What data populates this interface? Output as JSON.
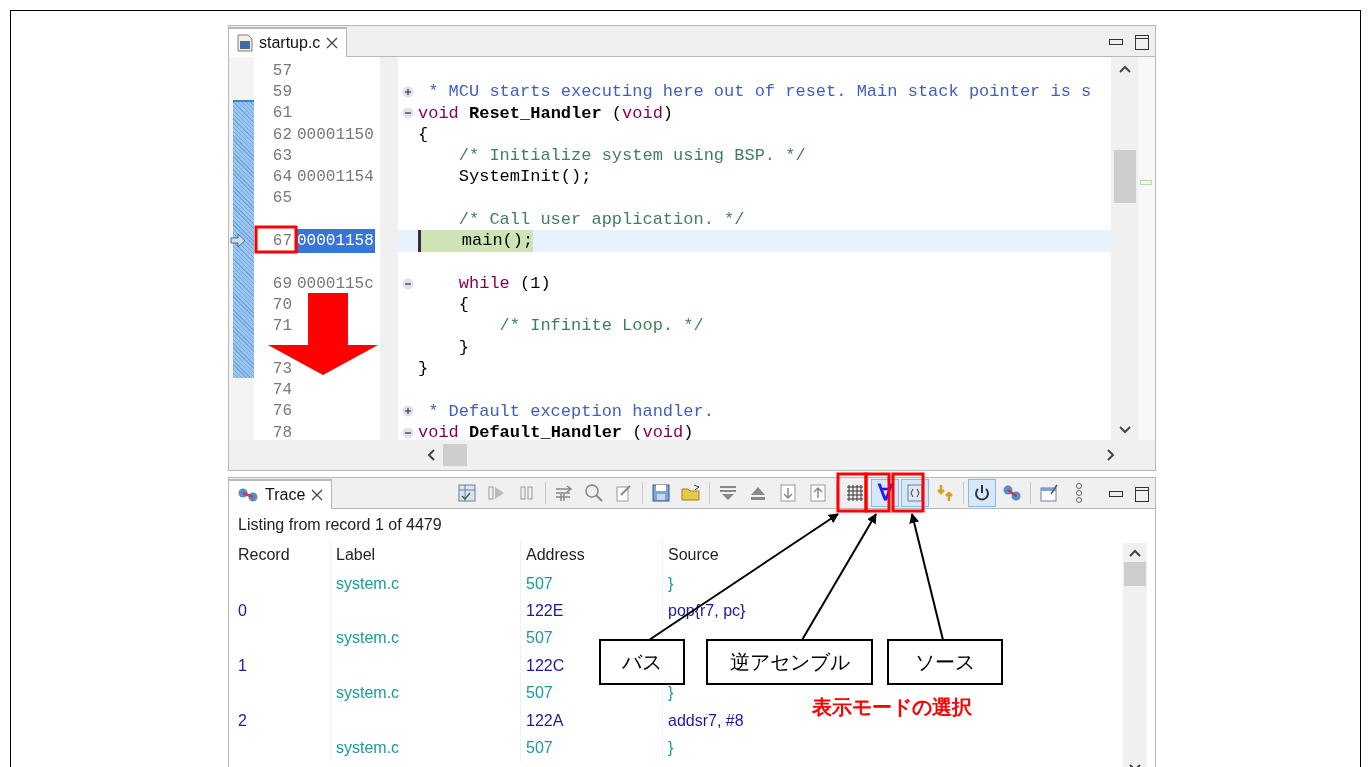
{
  "editor": {
    "tab": {
      "title": "startup.c",
      "selected": true
    },
    "lines": [
      {
        "number": "57",
        "current": false
      },
      {
        "number": "59",
        "expanded": false,
        "current": false,
        "code": [
          {
            "kind": "doc",
            "text": " * MCU starts executing here out of reset. Main stack pointer is s"
          }
        ]
      },
      {
        "number": "61",
        "expanded": true,
        "current": false,
        "code": [
          {
            "kind": "keyword",
            "text": "void"
          },
          {
            "kind": "name",
            "text": " Reset_Handler "
          },
          {
            "kind": "plain",
            "text": "("
          },
          {
            "kind": "keyword",
            "text": "void"
          },
          {
            "kind": "plain",
            "text": ")"
          }
        ]
      },
      {
        "number": "62",
        "address": "00001150",
        "current": false,
        "code": [
          {
            "kind": "plain",
            "text": "{"
          }
        ]
      },
      {
        "number": "63",
        "current": false,
        "code": [
          {
            "kind": "comment",
            "text": "    /* Initialize system using BSP. */"
          }
        ]
      },
      {
        "number": "64",
        "address": "00001154",
        "current": false,
        "code": [
          {
            "kind": "plain",
            "text": "    SystemInit();"
          }
        ]
      },
      {
        "number": "65",
        "current": false
      },
      {
        "current": false,
        "code": [
          {
            "kind": "comment",
            "text": "    /* Call user application. */"
          }
        ]
      },
      {
        "number": "67",
        "address": "00001158",
        "current": true,
        "code": [
          {
            "kind": "marked",
            "text": "    main();"
          }
        ]
      },
      {
        "current": false
      },
      {
        "number": "69",
        "address": "0000115c",
        "expanded": true,
        "current": false,
        "code": [
          {
            "kind": "keyword",
            "text": "    while"
          },
          {
            "kind": "plain",
            "text": " (1)"
          }
        ]
      },
      {
        "number": "70",
        "current": false,
        "code": [
          {
            "kind": "plain",
            "text": "    {"
          }
        ]
      },
      {
        "number": "71",
        "current": false,
        "code": [
          {
            "kind": "comment",
            "text": "        /* Infinite Loop. */"
          }
        ]
      },
      {
        "current": false,
        "code": [
          {
            "kind": "plain",
            "text": "    }"
          }
        ]
      },
      {
        "number": "73",
        "current": false,
        "code": [
          {
            "kind": "plain",
            "text": "}"
          }
        ]
      },
      {
        "number": "74",
        "current": false
      },
      {
        "number": "76",
        "expanded": false,
        "current": false,
        "code": [
          {
            "kind": "doc",
            "text": " * Default exception handler."
          }
        ]
      },
      {
        "number": "78",
        "expanded": true,
        "current": false,
        "code": [
          {
            "kind": "keyword",
            "text": "void"
          },
          {
            "kind": "name",
            "text": " Default_Handler "
          },
          {
            "kind": "plain",
            "text": "("
          },
          {
            "kind": "keyword",
            "text": "void"
          },
          {
            "kind": "plain",
            "text": ")"
          }
        ]
      }
    ]
  },
  "trace": {
    "tab": {
      "title": "Trace",
      "selected": true
    },
    "toolbar": [
      {
        "kind": "table",
        "selected": false
      },
      {
        "kind": "run",
        "selected": false
      },
      {
        "kind": "pause",
        "selected": false
      },
      {
        "kind": "separator"
      },
      {
        "kind": "arrows",
        "selected": false
      },
      {
        "kind": "search",
        "selected": false
      },
      {
        "kind": "edit",
        "selected": false
      },
      {
        "kind": "separator"
      },
      {
        "kind": "save",
        "selected": false
      },
      {
        "kind": "folder",
        "selected": false
      },
      {
        "kind": "separator"
      },
      {
        "kind": "filter",
        "selected": false
      },
      {
        "kind": "eject",
        "selected": false
      },
      {
        "kind": "stepdown",
        "selected": false
      },
      {
        "kind": "stepup",
        "selected": false
      },
      {
        "kind": "separator"
      },
      {
        "kind": "grid",
        "selected": false
      },
      {
        "kind": "glyph",
        "text": "∀",
        "selected": true
      },
      {
        "kind": "source",
        "selected": true
      },
      {
        "kind": "swap",
        "selected": false
      },
      {
        "kind": "separator"
      },
      {
        "kind": "power",
        "selected": true
      },
      {
        "kind": "link",
        "selected": false
      },
      {
        "kind": "separator"
      },
      {
        "kind": "window",
        "selected": false
      },
      {
        "kind": "dots",
        "selected": false
      }
    ],
    "listing": "Listing from record 1 of 4479",
    "columns": [
      "Record",
      "Label",
      "Address",
      "Source"
    ],
    "rows": [
      {
        "kind": "source",
        "label": "system.c",
        "address": "507",
        "source": "}"
      },
      {
        "kind": "asm",
        "record": "0",
        "address": "122E",
        "source": "pop{r7, pc}"
      },
      {
        "kind": "source",
        "label": "system.c",
        "address": "507"
      },
      {
        "kind": "asm",
        "record": "1",
        "address": "122C"
      },
      {
        "kind": "source",
        "label": "system.c",
        "address": "507",
        "source": "}"
      },
      {
        "kind": "asm",
        "record": "2",
        "address": "122A",
        "source": "addsr7, #8"
      },
      {
        "kind": "source",
        "label": "system.c",
        "address": "507",
        "source": "}"
      }
    ]
  },
  "annotations": {
    "callouts": [
      "バス",
      "逆アセンブル",
      "ソース"
    ],
    "caption": "表示モードの選択"
  }
}
